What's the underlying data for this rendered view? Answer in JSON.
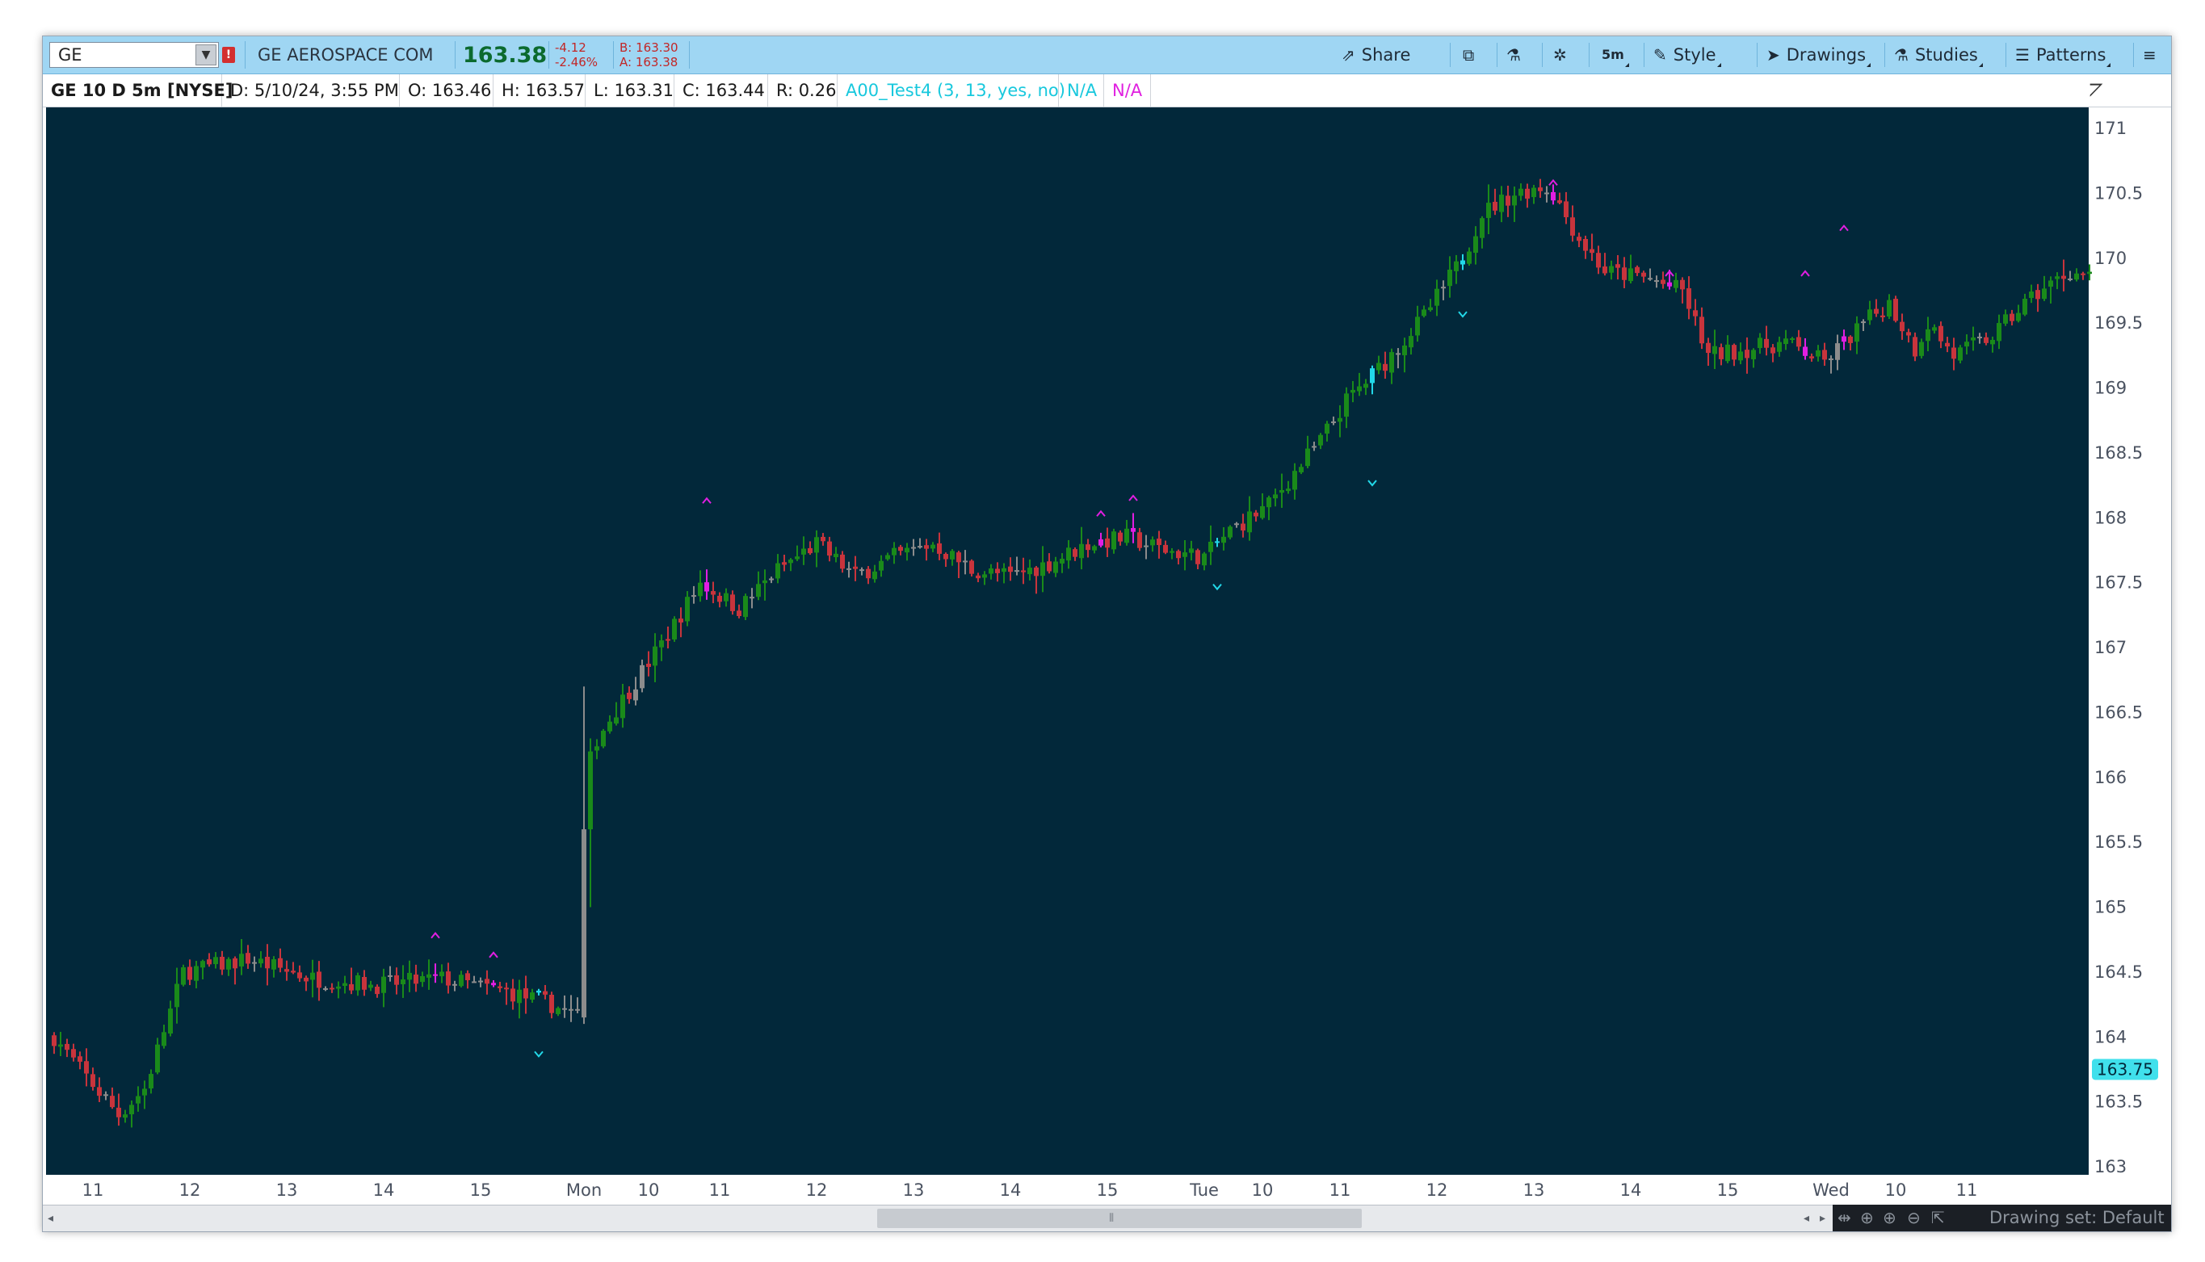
{
  "toolbar": {
    "symbol": "GE",
    "alert_badge": "!",
    "company": "GE AEROSPACE COM",
    "last_price": "163.38",
    "net_change": "-4.12",
    "pct_change": "-2.46%",
    "bid": "B: 163.30",
    "ask": "A: 163.38",
    "share_label": "Share",
    "timeframe_label": "5m",
    "style_label": "Style",
    "drawings_label": "Drawings",
    "studies_label": "Studies",
    "patterns_label": "Patterns",
    "icons": [
      "share-icon",
      "snapshot-icon",
      "flask-icon",
      "gear-icon",
      "cursor-icon",
      "studies-flask-icon",
      "patterns-icon",
      "menu-icon"
    ]
  },
  "infobar": {
    "title": "GE 10 D 5m [NYSE]",
    "date": "D: 5/10/24, 3:55 PM",
    "open": "O: 163.46",
    "high": "H: 163.57",
    "low": "L: 163.31",
    "close": "C: 163.44",
    "range": "R: 0.26",
    "study": "A00_Test4 (3, 13, yes, no)",
    "study_val1": "N/A",
    "study_val2": "N/A"
  },
  "statusbar": {
    "drawing_set": "Drawing set: Default"
  },
  "colors": {
    "background": "#02283a",
    "up": "#1a8a1a",
    "down": "#c8343c",
    "neutral": "#8c8c8c",
    "signal_up": "#22d8e8",
    "signal_down": "#e21ee2",
    "price_bubble": "#40e0ec"
  },
  "chart_data": {
    "type": "candlestick",
    "title": "GE 10 D 5m [NYSE]",
    "y_axis_side": "right",
    "ylim": [
      163.0,
      171.1
    ],
    "y_ticks": [
      163,
      163.5,
      164,
      164.5,
      165,
      165.5,
      166,
      166.5,
      167,
      167.5,
      168,
      168.5,
      169,
      169.5,
      170,
      170.5,
      171
    ],
    "y_tick_labels": [
      "163",
      "163.5",
      "164",
      "164.5",
      "165",
      "165.5",
      "166",
      "166.5",
      "167",
      "167.5",
      "168",
      "168.5",
      "169",
      "169.5",
      "170",
      "170.5",
      "171"
    ],
    "price_bubble": "163.75",
    "price_bubble_value": 163.75,
    "x_tick_labels": [
      "11",
      "12",
      "13",
      "14",
      "15",
      "Mon",
      "10",
      "11",
      "12",
      "13",
      "14",
      "15",
      "Tue",
      "10",
      "11",
      "12",
      "13",
      "14",
      "15",
      "Wed",
      "10",
      "11"
    ],
    "x_tick_bar_index": [
      6,
      21,
      36,
      51,
      66,
      82,
      92,
      103,
      118,
      133,
      148,
      163,
      178,
      187,
      199,
      214,
      229,
      244,
      259,
      275,
      285,
      296
    ],
    "grid": false,
    "legend": "none",
    "waypoints": [
      [
        0,
        164.0
      ],
      [
        4,
        163.75
      ],
      [
        10,
        163.4
      ],
      [
        14,
        163.6
      ],
      [
        20,
        164.5
      ],
      [
        30,
        164.6
      ],
      [
        40,
        164.45
      ],
      [
        50,
        164.4
      ],
      [
        60,
        164.45
      ],
      [
        70,
        164.35
      ],
      [
        77,
        164.25
      ],
      [
        81,
        164.15
      ],
      [
        82,
        165.6
      ],
      [
        84,
        166.3
      ],
      [
        88,
        166.6
      ],
      [
        95,
        167.1
      ],
      [
        100,
        167.5
      ],
      [
        106,
        167.3
      ],
      [
        112,
        167.6
      ],
      [
        118,
        167.8
      ],
      [
        124,
        167.55
      ],
      [
        130,
        167.7
      ],
      [
        136,
        167.8
      ],
      [
        142,
        167.6
      ],
      [
        148,
        167.55
      ],
      [
        154,
        167.65
      ],
      [
        160,
        167.8
      ],
      [
        166,
        167.85
      ],
      [
        172,
        167.75
      ],
      [
        178,
        167.7
      ],
      [
        182,
        167.9
      ],
      [
        188,
        168.1
      ],
      [
        196,
        168.6
      ],
      [
        200,
        168.9
      ],
      [
        206,
        169.2
      ],
      [
        212,
        169.55
      ],
      [
        218,
        170.0
      ],
      [
        221,
        170.35
      ],
      [
        226,
        170.5
      ],
      [
        230,
        170.55
      ],
      [
        232,
        170.5
      ],
      [
        236,
        170.15
      ],
      [
        240,
        169.9
      ],
      [
        246,
        169.85
      ],
      [
        252,
        169.75
      ],
      [
        256,
        169.25
      ],
      [
        262,
        169.3
      ],
      [
        268,
        169.35
      ],
      [
        274,
        169.2
      ],
      [
        280,
        169.5
      ],
      [
        284,
        169.65
      ],
      [
        288,
        169.3
      ],
      [
        290,
        169.5
      ],
      [
        294,
        169.25
      ],
      [
        300,
        169.4
      ],
      [
        306,
        169.7
      ],
      [
        312,
        169.9
      ],
      [
        315,
        169.85
      ]
    ],
    "gap_spikes": [
      {
        "bar": 82,
        "open": 164.15,
        "high": 166.7,
        "low": 164.1,
        "close": 165.6
      },
      {
        "bar": 83,
        "open": 165.6,
        "high": 166.3,
        "low": 165.0,
        "close": 166.2
      }
    ],
    "signals_down": [
      {
        "bar": 59,
        "price": 164.75
      },
      {
        "bar": 68,
        "price": 164.6
      },
      {
        "bar": 101,
        "price": 168.1
      },
      {
        "bar": 162,
        "price": 168.0
      },
      {
        "bar": 167,
        "price": 168.12
      },
      {
        "bar": 232,
        "price": 170.55
      },
      {
        "bar": 250,
        "price": 169.85
      },
      {
        "bar": 271,
        "price": 169.85
      },
      {
        "bar": 277,
        "price": 170.2
      }
    ],
    "signals_up": [
      {
        "bar": 75,
        "price": 163.9
      },
      {
        "bar": 180,
        "price": 167.5
      },
      {
        "bar": 204,
        "price": 168.3
      },
      {
        "bar": 218,
        "price": 169.6
      }
    ]
  }
}
